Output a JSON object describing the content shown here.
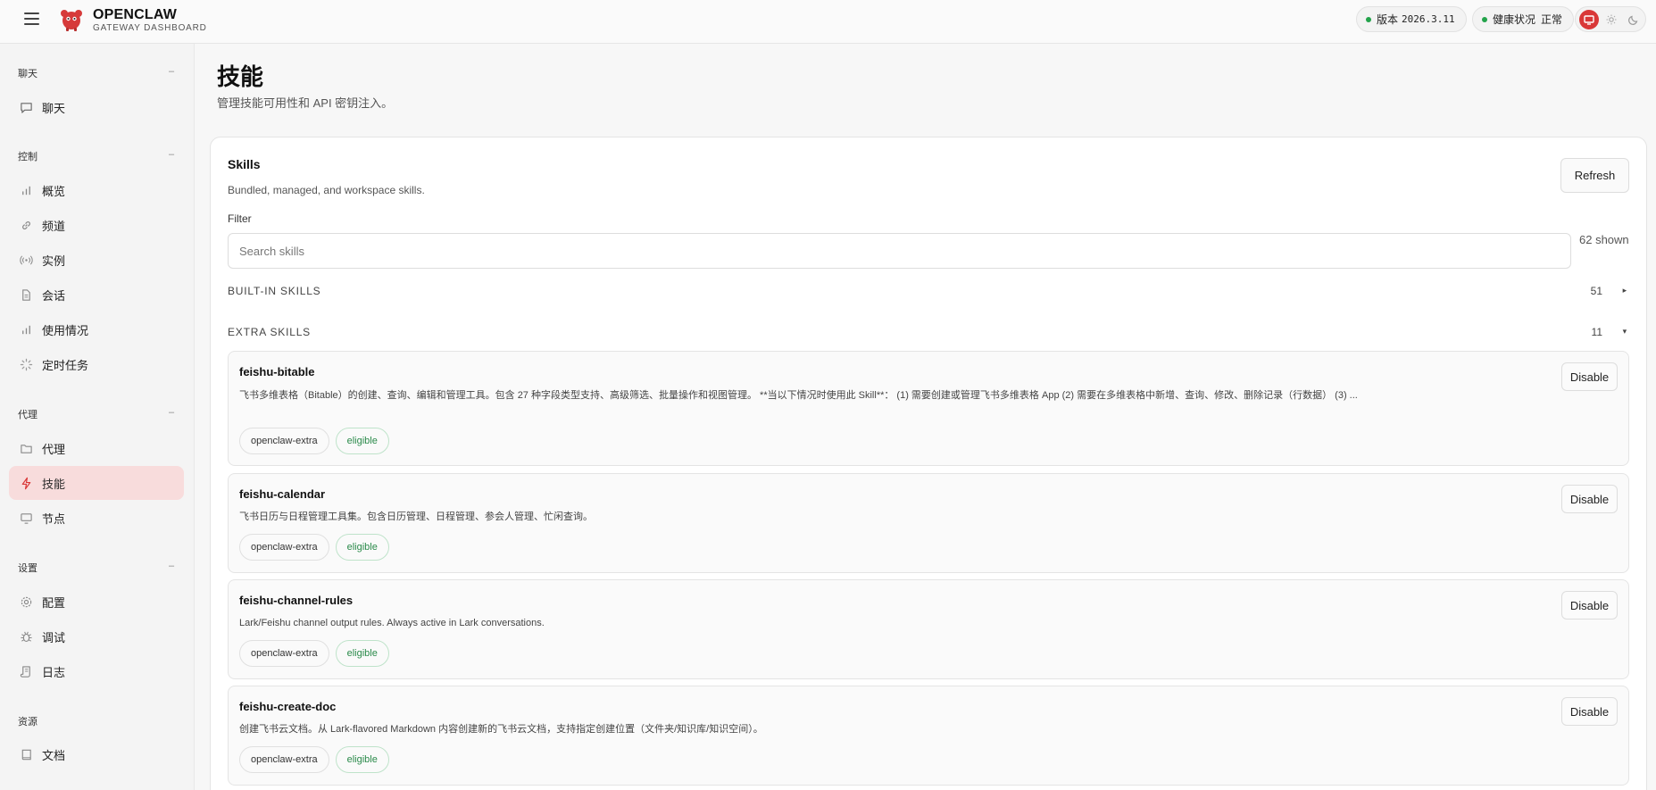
{
  "header": {
    "brand_title": "OPENCLAW",
    "brand_sub": "GATEWAY DASHBOARD",
    "version_label": "版本",
    "version_value": "2026.3.11",
    "health_label": "健康状况",
    "health_value": "正常"
  },
  "sidebar": {
    "sections": [
      {
        "title": "聊天",
        "items": [
          {
            "label": "聊天",
            "icon": "chat-icon"
          }
        ]
      },
      {
        "title": "控制",
        "items": [
          {
            "label": "概览",
            "icon": "bar-chart-icon"
          },
          {
            "label": "频道",
            "icon": "link-icon"
          },
          {
            "label": "实例",
            "icon": "radio-icon"
          },
          {
            "label": "会话",
            "icon": "document-icon"
          },
          {
            "label": "使用情况",
            "icon": "bar-chart-icon"
          },
          {
            "label": "定时任务",
            "icon": "loader-icon"
          }
        ]
      },
      {
        "title": "代理",
        "items": [
          {
            "label": "代理",
            "icon": "folder-icon"
          },
          {
            "label": "技能",
            "icon": "lightning-icon"
          },
          {
            "label": "节点",
            "icon": "monitor-icon"
          }
        ]
      },
      {
        "title": "设置",
        "items": [
          {
            "label": "配置",
            "icon": "gear-icon"
          },
          {
            "label": "调试",
            "icon": "bug-icon"
          },
          {
            "label": "日志",
            "icon": "scroll-icon"
          }
        ]
      },
      {
        "title": "资源",
        "items": [
          {
            "label": "文档",
            "icon": "book-icon"
          }
        ]
      }
    ],
    "collapse_glyph": "–",
    "active_item": "技能",
    "accent_color": "#d93838"
  },
  "main": {
    "title": "技能",
    "subtitle": "管理技能可用性和 API 密钥注入。",
    "card": {
      "title": "Skills",
      "subtitle": "Bundled, managed, and workspace skills.",
      "refresh_label": "Refresh",
      "filter_label": "Filter",
      "search_placeholder": "Search skills",
      "shown_text": "62 shown",
      "groups": [
        {
          "label": "BUILT-IN SKILLS",
          "count": "51",
          "caret": "▸"
        },
        {
          "label": "EXTRA SKILLS",
          "count": "11",
          "caret": "▾"
        }
      ],
      "skills": [
        {
          "name": "feishu-bitable",
          "description": "飞书多维表格（Bitable）的创建、查询、编辑和管理工具。包含 27 种字段类型支持、高级筛选、批量操作和视图管理。 **当以下情况时使用此 Skill**： (1) 需要创建或管理飞书多维表格 App (2) 需要在多维表格中新增、查询、修改、删除记录（行数据） (3) ...",
          "source": "openclaw-extra",
          "status": "eligible",
          "action": "Disable"
        },
        {
          "name": "feishu-calendar",
          "description": "飞书日历与日程管理工具集。包含日历管理、日程管理、参会人管理、忙闲查询。",
          "source": "openclaw-extra",
          "status": "eligible",
          "action": "Disable"
        },
        {
          "name": "feishu-channel-rules",
          "description": "Lark/Feishu channel output rules. Always active in Lark conversations.",
          "source": "openclaw-extra",
          "status": "eligible",
          "action": "Disable"
        },
        {
          "name": "feishu-create-doc",
          "description": "创建飞书云文档。从 Lark-flavored Markdown 内容创建新的飞书云文档，支持指定创建位置（文件夹/知识库/知识空间）。",
          "source": "openclaw-extra",
          "status": "eligible",
          "action": "Disable"
        }
      ]
    }
  }
}
